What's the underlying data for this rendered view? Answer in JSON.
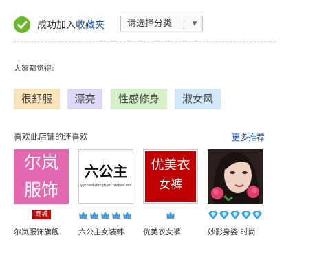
{
  "status": {
    "message_prefix": "成功加入",
    "message_link": "收藏夹",
    "icon": "check-circle-icon",
    "icon_color": "#6cb82c"
  },
  "category_select": {
    "selected": "请选择分类",
    "icon": "chevron-down-icon"
  },
  "opinion": {
    "heading": "大家都觉得:",
    "tags": [
      {
        "label": "很舒服",
        "color": "#fbe3b9"
      },
      {
        "label": "漂亮",
        "color": "#e0d8f7"
      },
      {
        "label": "性感修身",
        "color": "#d4f1c8"
      },
      {
        "label": "淑女风",
        "color": "#d2e8f8"
      }
    ]
  },
  "recommend": {
    "heading": "喜欢此店铺的还喜欢",
    "more_link": "更多推荐",
    "shops": [
      {
        "name": "尔岚服饰旗舰",
        "logo_line1": "尔岚",
        "logo_line2": "服饰",
        "badge_label": "商城",
        "badge_type": "tmall-badge",
        "bg_color": "#e268b0"
      },
      {
        "name": "六公主女装韩",
        "logo_text": "六公主",
        "logo_subtext": "yychaolufengtuan.taobao.com",
        "badge_type": "crown-icon",
        "badge_count": 5
      },
      {
        "name": "优美衣女裤",
        "logo_line1": "优美衣",
        "logo_line2": "女裤",
        "badge_type": "crown-icon",
        "badge_count": 1,
        "bg_color": "#c00000"
      },
      {
        "name": "妙影身姿 时尚",
        "badge_type": "diamond-icon",
        "badge_count": 5
      }
    ]
  }
}
